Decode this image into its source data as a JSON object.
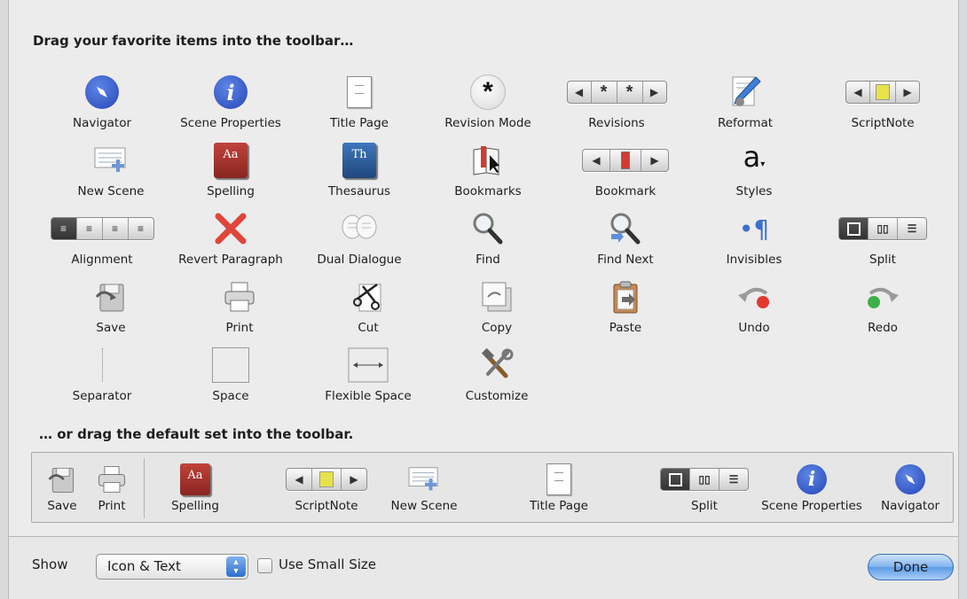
{
  "headings": {
    "top": "Drag your favorite items into the toolbar…",
    "default": "… or drag the default set into the toolbar."
  },
  "items": [
    {
      "label": "Navigator",
      "icon": "compass-icon"
    },
    {
      "label": "Scene Properties",
      "icon": "info-icon"
    },
    {
      "label": "Title Page",
      "icon": "document-icon"
    },
    {
      "label": "Revision Mode",
      "icon": "asterisk-icon"
    },
    {
      "label": "Revisions",
      "icon": "revisions-stepper-icon"
    },
    {
      "label": "Reformat",
      "icon": "reformat-pencil-icon"
    },
    {
      "label": "ScriptNote",
      "icon": "scriptnote-stepper-icon"
    },
    {
      "label": "New Scene",
      "icon": "new-scene-icon"
    },
    {
      "label": "Spelling",
      "icon": "spelling-book-icon"
    },
    {
      "label": "Thesaurus",
      "icon": "thesaurus-book-icon"
    },
    {
      "label": "Bookmarks",
      "icon": "bookmarks-icon"
    },
    {
      "label": "Bookmark",
      "icon": "bookmark-stepper-icon"
    },
    {
      "label": "Styles",
      "icon": "styles-icon"
    },
    {
      "label": "Alignment",
      "icon": "alignment-icon"
    },
    {
      "label": "Revert Paragraph",
      "icon": "red-x-icon"
    },
    {
      "label": "Dual Dialogue",
      "icon": "dual-dialogue-icon"
    },
    {
      "label": "Find",
      "icon": "magnifier-icon"
    },
    {
      "label": "Find Next",
      "icon": "find-next-icon"
    },
    {
      "label": "Invisibles",
      "icon": "pilcrow-icon"
    },
    {
      "label": "Split",
      "icon": "split-icon"
    },
    {
      "label": "Save",
      "icon": "save-icon"
    },
    {
      "label": "Print",
      "icon": "printer-icon"
    },
    {
      "label": "Cut",
      "icon": "scissors-icon"
    },
    {
      "label": "Copy",
      "icon": "copy-icon"
    },
    {
      "label": "Paste",
      "icon": "clipboard-icon"
    },
    {
      "label": "Undo",
      "icon": "undo-icon"
    },
    {
      "label": "Redo",
      "icon": "redo-icon"
    },
    {
      "label": "Separator",
      "icon": "separator-icon"
    },
    {
      "label": "Space",
      "icon": "space-icon"
    },
    {
      "label": "Flexible Space",
      "icon": "flexible-space-icon"
    },
    {
      "label": "Customize",
      "icon": "tools-icon"
    }
  ],
  "default_set": [
    {
      "label": "Save",
      "icon": "save-icon"
    },
    {
      "label": "Print",
      "icon": "printer-icon"
    },
    {
      "label": "Spelling",
      "icon": "spelling-book-icon"
    },
    {
      "label": "ScriptNote",
      "icon": "scriptnote-stepper-icon"
    },
    {
      "label": "New Scene",
      "icon": "new-scene-icon"
    },
    {
      "label": "Title Page",
      "icon": "document-icon"
    },
    {
      "label": "Split",
      "icon": "split-icon"
    },
    {
      "label": "Scene Properties",
      "icon": "info-icon"
    },
    {
      "label": "Navigator",
      "icon": "compass-icon"
    }
  ],
  "footer": {
    "show_label": "Show",
    "show_value": "Icon & Text",
    "small_size_label": "Use Small Size",
    "small_size_checked": false,
    "done_label": "Done"
  },
  "colors": {
    "accent_blue": "#2d5bc7",
    "spelling_red": "#a8312b",
    "thesaurus_blue": "#2c5f9e",
    "revert_red": "#e0453a"
  }
}
